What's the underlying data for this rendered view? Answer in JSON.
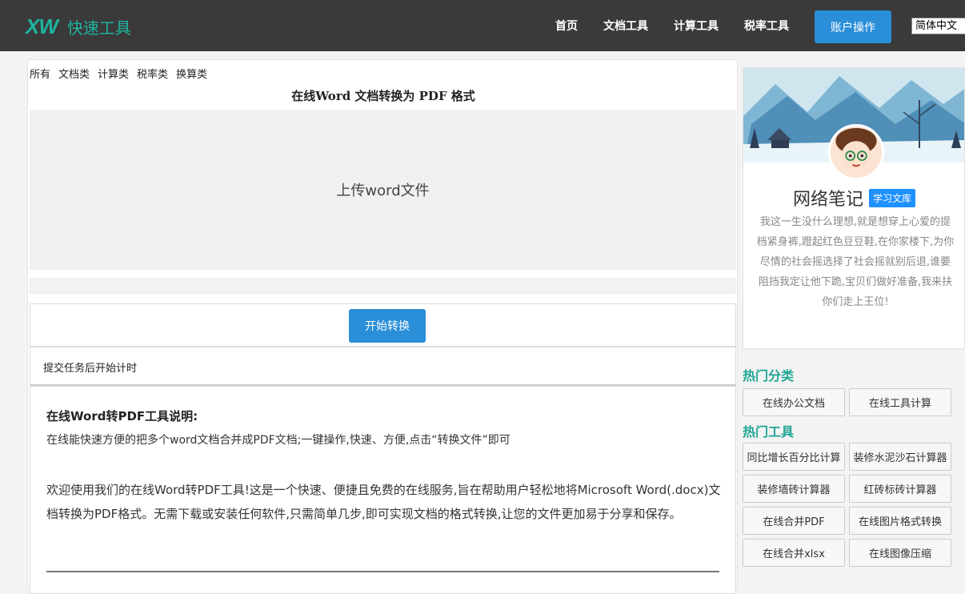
{
  "header": {
    "logo_mark": "XW",
    "logo_text": "快速工具",
    "nav": [
      "首页",
      "文档工具",
      "计算工具",
      "税率工具"
    ],
    "account_button": "账户操作",
    "language": "简体中文"
  },
  "main": {
    "categories": [
      "所有",
      "文档类",
      "计算类",
      "税率类",
      "换算类"
    ],
    "title": "在线Word 文档转换为 PDF 格式",
    "upload_label": "上传word文件",
    "convert_button": "开始转换",
    "timer_text": "提交任务后开始计时",
    "description": {
      "heading": "在线Word转PDF工具说明:",
      "line1": "在线能快速方便的把多个word文档合并成PDF文档;一键操作,快速、方便,点击“转换文件”即可",
      "paragraph": "欢迎使用我们的在线Word转PDF工具!这是一个快速、便捷且免费的在线服务,旨在帮助用户轻松地将Microsoft Word(.docx)文档转换为PDF格式。无需下载或安装任何软件,只需简单几步,即可实现文档的格式转换,让您的文件更加易于分享和保存。"
    }
  },
  "sidebar": {
    "profile": {
      "name": "网络笔记",
      "badge": "学习文库",
      "bio": "我这一生没什么理想,就是想穿上心爱的提档紧身裤,蹬起红色豆豆鞋,在你家楼下,为你尽情的社会摇选择了社会摇就别后退,谁要阻挡我定让他下跪,宝贝们做好准备,我来扶你们走上王位!"
    },
    "hot_categories_title": "热门分类",
    "hot_categories": [
      "在线办公文档",
      "在线工具计算"
    ],
    "hot_tools_title": "热门工具",
    "hot_tools": [
      "同比增长百分比计算",
      "装修水泥沙石计算器",
      "装修墙砖计算器",
      "红砖标砖计算器",
      "在线合并PDF",
      "在线图片格式转换",
      "在线合并xlsx",
      "在线图像压缩"
    ]
  },
  "colors": {
    "topbar": "#3a3a3a",
    "brand": "#1fb4a0",
    "button": "#2a8ed8",
    "section_title": "#1fa595",
    "badge": "#1e90ff"
  }
}
